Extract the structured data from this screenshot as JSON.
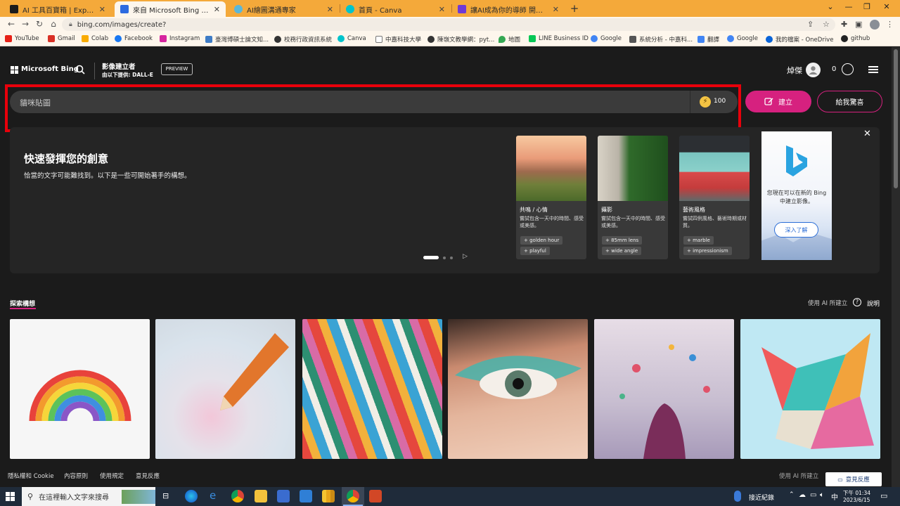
{
  "browser": {
    "tabs": [
      {
        "label": "AI 工具百寶箱 | ExplainThis",
        "color": "#1b1b1b"
      },
      {
        "label": "來自 Microsoft Bing 的影像建立",
        "color": "#2d6be0"
      },
      {
        "label": "AI繪圖溝通專家",
        "color": "#5bb7d9"
      },
      {
        "label": "首頁 - Canva",
        "color": "#00c4cc"
      },
      {
        "label": "讓AI成為你的導師 開啟一場智能",
        "color": "#6f3ad6"
      }
    ],
    "url": "bing.com/images/create?",
    "bookmarks": [
      {
        "label": "YouTube",
        "color": "#e62117"
      },
      {
        "label": "Gmail",
        "color": "#d93025"
      },
      {
        "label": "Colab",
        "color": "#f9ab00"
      },
      {
        "label": "Facebook",
        "color": "#1877f2"
      },
      {
        "label": "Instagram",
        "color": "#d6249f"
      },
      {
        "label": "臺灣博碩士論文知...",
        "color": "#3f7cc6"
      },
      {
        "label": "校務行政資訊系統",
        "color": "#333333"
      },
      {
        "label": "Canva",
        "color": "#00c4cc"
      },
      {
        "label": "中嘉科技大學",
        "color": "#777777"
      },
      {
        "label": "陳嶺文教學網：pyt...",
        "color": "#333333"
      },
      {
        "label": "地圖",
        "color": "#34a853"
      },
      {
        "label": "LINE Business ID",
        "color": "#06c755"
      },
      {
        "label": "Google",
        "color": "#4285f4"
      },
      {
        "label": "系統分析 - 中嘉科...",
        "color": "#555555"
      },
      {
        "label": "翻譯",
        "color": "#4285f4"
      },
      {
        "label": "Google",
        "color": "#4285f4"
      },
      {
        "label": "我的檔案 - OneDrive",
        "color": "#0a64d8"
      },
      {
        "label": "github",
        "color": "#222222"
      }
    ]
  },
  "header": {
    "brand": "Microsoft Bing",
    "product": "影像建立者",
    "provider": "由以下提供: DALL-E",
    "preview": "PREVIEW",
    "user": "焯傑",
    "rewards": "0"
  },
  "prompt": {
    "text": "貓咪貼圖",
    "boosts": "100",
    "create_label": "建立",
    "surprise_label": "給我驚喜"
  },
  "tips": {
    "title": "快速發揮您的創意",
    "subtitle": "恰當的文字可能難找到。以下是一些可開始著手的構想。",
    "cards": [
      {
        "title": "共鳴 / 心情",
        "desc": "嘗試包含一天中的時間、感受或美感。",
        "chips": [
          "golden hour",
          "playful"
        ]
      },
      {
        "title": "攝影",
        "desc": "嘗試包含一天中的時間、感受或美感。",
        "chips": [
          "85mm lens",
          "wide angle"
        ]
      },
      {
        "title": "藝術風格",
        "desc": "嘗試四例風格、藝術時期或材質。",
        "chips": [
          "marble",
          "impressionism"
        ]
      }
    ],
    "ad_text": "您現在可以在新的 Bing 中建立影像。",
    "ad_button": "深入了解",
    "active_dot": 0
  },
  "explore": {
    "tab_label": "探索構想",
    "made_with_ai": "使用 AI 所建立",
    "help": "說明"
  },
  "footer": {
    "links": [
      "隱私權和 Cookie",
      "內容原則",
      "使用規定",
      "意見反應"
    ],
    "made_with_ai": "使用 AI 所建立",
    "feedback": "意見反應"
  },
  "taskbar": {
    "search_placeholder": "在這裡輸入文字來搜尋",
    "weather": "接近紀錄",
    "ime": "中",
    "time": "下午 01:34",
    "date": "2023/6/15"
  }
}
